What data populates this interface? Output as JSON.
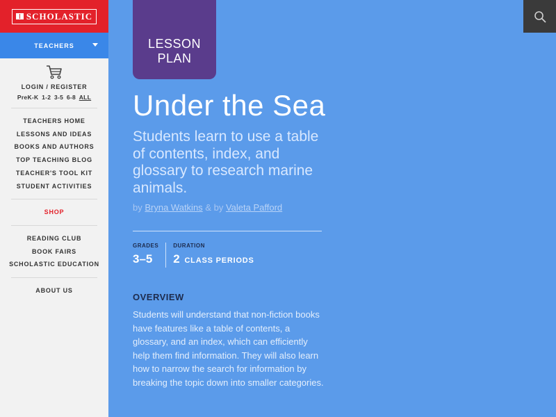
{
  "brand": {
    "name": "SCHOLASTIC"
  },
  "role_selector": {
    "label": "TEACHERS"
  },
  "account": {
    "login_label": "LOGIN / REGISTER",
    "grade_links": [
      "PreK-K",
      "1-2",
      "3-5",
      "6-8",
      "ALL"
    ]
  },
  "nav_groups": {
    "main": [
      "TEACHERS HOME",
      "LESSONS AND IDEAS",
      "BOOKS AND AUTHORS",
      "TOP TEACHING BLOG",
      "TEACHER'S TOOL KIT",
      "STUDENT ACTIVITIES"
    ],
    "shop": "SHOP",
    "programs": [
      "READING CLUB",
      "BOOK FAIRS",
      "SCHOLASTIC EDUCATION"
    ],
    "about": "ABOUT US"
  },
  "lesson": {
    "badge_line1": "LESSON",
    "badge_line2": "PLAN",
    "title": "Under the Sea",
    "subtitle": "Students learn to use a table of contents, index, and glossary to research marine animals.",
    "by1": "by",
    "author1": "Bryna  Watkins",
    "amp": "&",
    "by2": "by",
    "author2": "Valeta  Pafford",
    "grades_label": "GRADES",
    "grades_value": "3–5",
    "duration_label": "DURATION",
    "duration_value": "2",
    "duration_unit": "CLASS PERIODS",
    "overview_heading": "OVERVIEW",
    "overview_text": "Students will understand that non-fiction books have features like a table of contents, a glossary, and an index, which can efficiently help them find information. They will also learn how to narrow the search for information by breaking the topic down into smaller categories."
  },
  "icons": {
    "logo": "scholastic-book-icon",
    "cart": "cart-icon",
    "search": "search-icon",
    "caret": "chevron-down-icon"
  },
  "colors": {
    "brand_red": "#e3212a",
    "role_blue": "#3a87e8",
    "page_blue": "#5b9bea",
    "badge_purple": "#5a3c8c"
  }
}
